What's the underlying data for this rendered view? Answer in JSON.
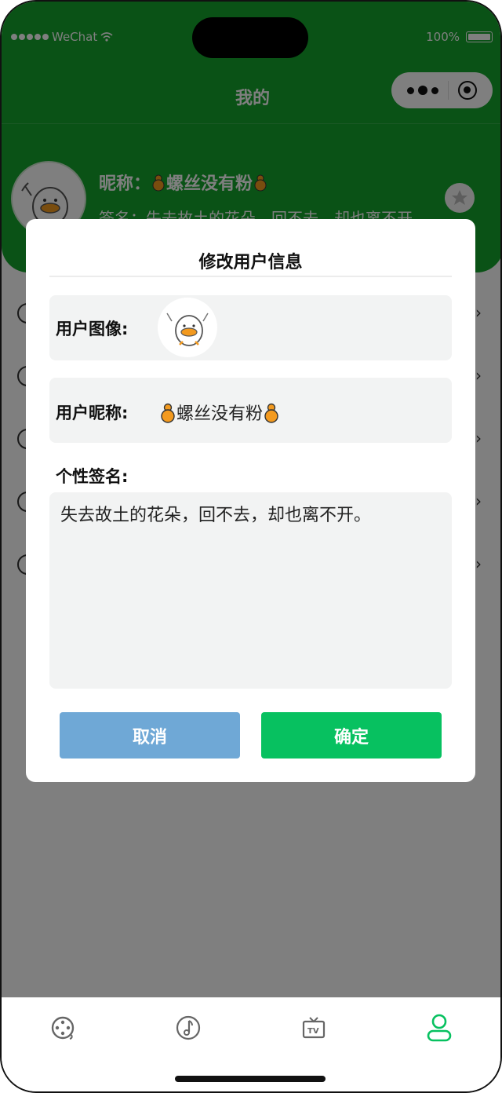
{
  "status_bar": {
    "carrier": "WeChat",
    "battery": "100%"
  },
  "nav": {
    "title": "我的"
  },
  "profile": {
    "nickname_label": "昵称：",
    "nickname": "螺丝没有粉",
    "signature_text": "签名：失去故土的花朵，回不去，却也离不开"
  },
  "menu": {
    "item_count_visible": 5
  },
  "modal": {
    "title": "修改用户信息",
    "avatar_label": "用户图像:",
    "nickname_label": "用户昵称:",
    "nickname_value": "螺丝没有粉",
    "signature_label": "个性签名:",
    "signature_value": "失去故土的花朵，回不去，却也离不开。",
    "cancel_label": "取消",
    "confirm_label": "确定"
  },
  "tabbar": {
    "tabs": [
      {
        "icon": "film-reel-icon",
        "active": false
      },
      {
        "icon": "music-note-icon",
        "active": false
      },
      {
        "icon": "tv-icon",
        "active": false
      },
      {
        "icon": "user-icon",
        "active": true
      }
    ],
    "active_color": "#07c160",
    "inactive_color": "#666666"
  },
  "colors": {
    "header": "#14a42c",
    "cancel": "#6fa8d6",
    "confirm": "#07c160"
  }
}
